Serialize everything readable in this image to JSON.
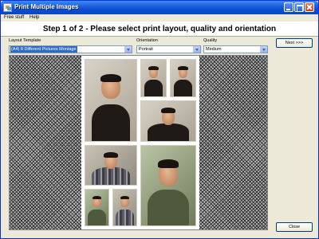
{
  "window": {
    "title": "Print Multiple Images"
  },
  "menu": {
    "items": [
      "Free stuff",
      "Help"
    ]
  },
  "banner": {
    "heading": "Step 1 of 2 - Please select print layout, quality and orientation"
  },
  "fields": {
    "layout": {
      "label": "Layout Template",
      "value": "(A4) 8 Different Pictures Montage"
    },
    "orientation": {
      "label": "Orientation",
      "value": "Portrait"
    },
    "quality": {
      "label": "Quality",
      "value": "Medium"
    }
  },
  "buttons": {
    "next": "Next >>>",
    "close": "Close"
  },
  "colors": {
    "titlebar": "#0a4ad0",
    "selection": "#316ac5",
    "dialog": "#ece9d8"
  },
  "photos": [
    {
      "name": "photo-leather-jacket-large",
      "scene": "leather-jacket"
    },
    {
      "name": "photo-leather-jacket-small-1",
      "scene": "leather-jacket"
    },
    {
      "name": "photo-leather-jacket-small-2",
      "scene": "leather-jacket"
    },
    {
      "name": "photo-leather-jacket-medium",
      "scene": "leather-jacket"
    },
    {
      "name": "photo-plaid-shirt",
      "scene": "plaid-shirt"
    },
    {
      "name": "photo-green-jacket-large",
      "scene": "green-jacket"
    },
    {
      "name": "photo-green-jacket-small",
      "scene": "green-jacket"
    },
    {
      "name": "photo-plaid-shirt-small",
      "scene": "plaid-shirt"
    }
  ]
}
